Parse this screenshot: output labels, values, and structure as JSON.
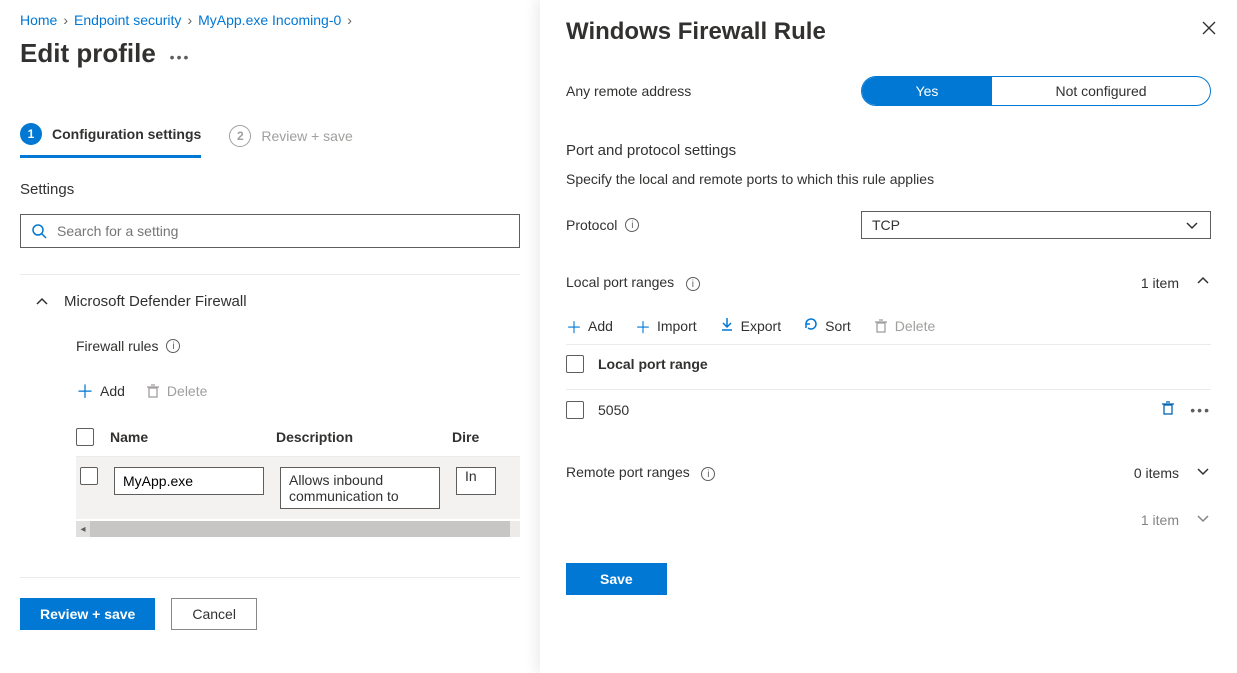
{
  "breadcrumb": {
    "home": "Home",
    "section": "Endpoint security",
    "item": "MyApp.exe Incoming-0"
  },
  "page_title": "Edit profile",
  "steps": {
    "s1_num": "1",
    "s1_label": "Configuration settings",
    "s2_num": "2",
    "s2_label": "Review + save"
  },
  "settings_heading": "Settings",
  "search_placeholder": "Search for a setting",
  "section_title": "Microsoft Defender Firewall",
  "firewall_rules_label": "Firewall rules",
  "toolbar": {
    "add": "Add",
    "delete": "Delete"
  },
  "table": {
    "col_name": "Name",
    "col_desc": "Description",
    "col_dir": "Dire",
    "row1_name": "MyApp.exe",
    "row1_desc": "Allows inbound communication to",
    "row1_dir": "In"
  },
  "footer": {
    "review_save": "Review + save",
    "cancel": "Cancel"
  },
  "flyout": {
    "title": "Windows Firewall Rule",
    "any_remote_label": "Any remote address",
    "toggle_yes": "Yes",
    "toggle_not": "Not configured",
    "port_section_title": "Port and protocol settings",
    "port_section_desc": "Specify the local and remote ports to which this rule applies",
    "protocol_label": "Protocol",
    "protocol_value": "TCP",
    "local_ranges_label": "Local port ranges",
    "local_ranges_count": "1 item",
    "mini_add": "Add",
    "mini_import": "Import",
    "mini_export": "Export",
    "mini_sort": "Sort",
    "mini_delete": "Delete",
    "port_col_header": "Local port range",
    "port_value": "5050",
    "remote_ranges_label": "Remote port ranges",
    "remote_ranges_count": "0 items",
    "bottom_count": "1 item",
    "save": "Save"
  }
}
